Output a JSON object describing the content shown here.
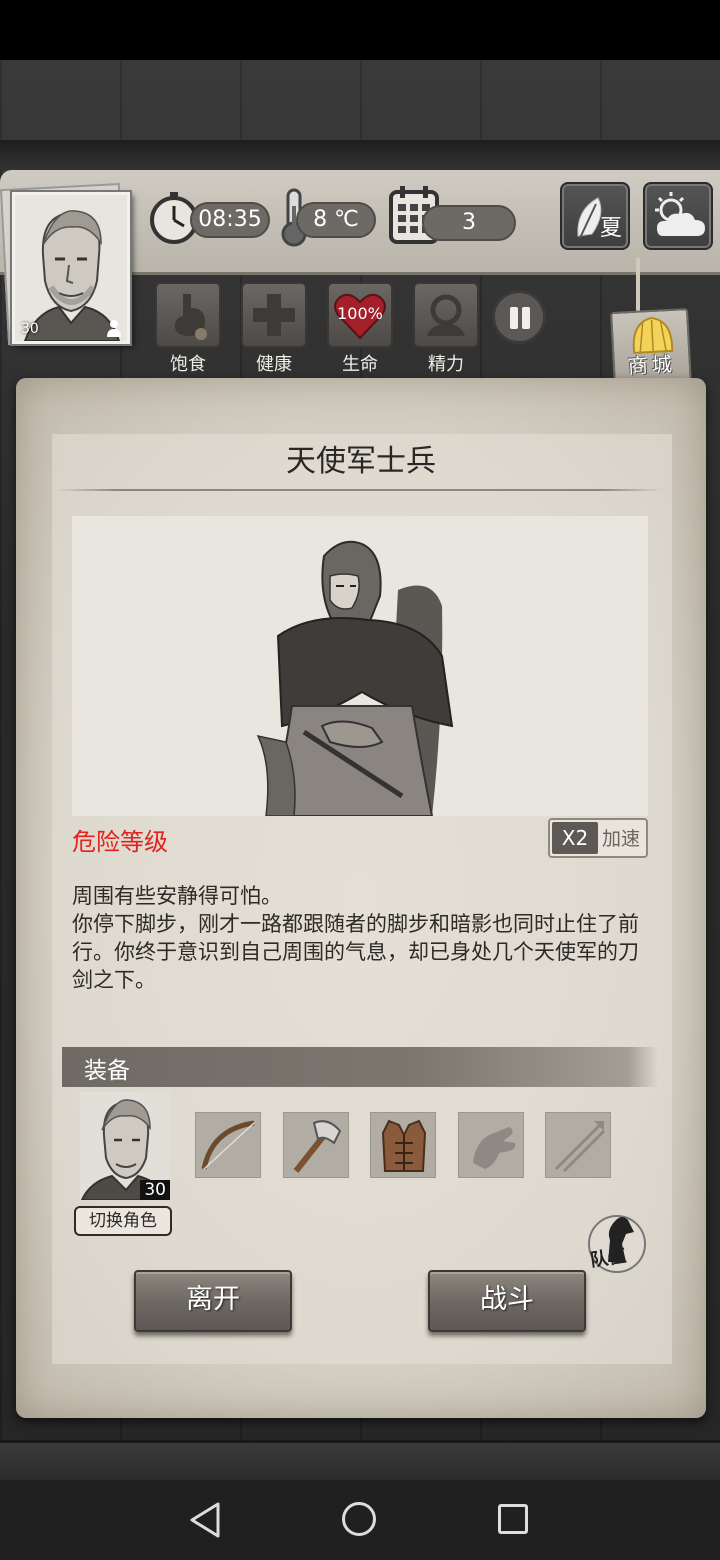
{
  "hud": {
    "time": "08:35",
    "temperature": "8 ℃",
    "day": "3",
    "season": "夏",
    "player_level": "30"
  },
  "stats": [
    {
      "label": "饱食",
      "icon": "stomach-icon"
    },
    {
      "label": "健康",
      "icon": "cross-icon"
    },
    {
      "label": "生命",
      "icon": "heart-icon",
      "value": "100%"
    },
    {
      "label": "精力",
      "icon": "head-icon"
    }
  ],
  "shop": {
    "label": "商城"
  },
  "dialog": {
    "title": "天使军士兵",
    "danger_label": "危险等级",
    "speed": {
      "multiplier": "X2",
      "label": "加速"
    },
    "story_lines": [
      "周围有些安静得可怕。",
      "你停下脚步，刚才一路都跟随者的脚步和暗影也同时止住了前行。你终于意识到自己周围的气息，却已身处几个天使军的刀剑之下。"
    ],
    "equipment": {
      "section_label": "装备",
      "hero_level": "30",
      "switch_label": "切换角色",
      "slots": [
        "bow-icon",
        "axe-icon",
        "vest-icon",
        "glove-icon",
        "arrows-icon"
      ]
    },
    "team_label": "队伍",
    "leave_label": "离开",
    "fight_label": "战斗"
  },
  "colors": {
    "danger": "#e2221d",
    "button": "#6e6963",
    "parchment": "#d6d0c5"
  }
}
